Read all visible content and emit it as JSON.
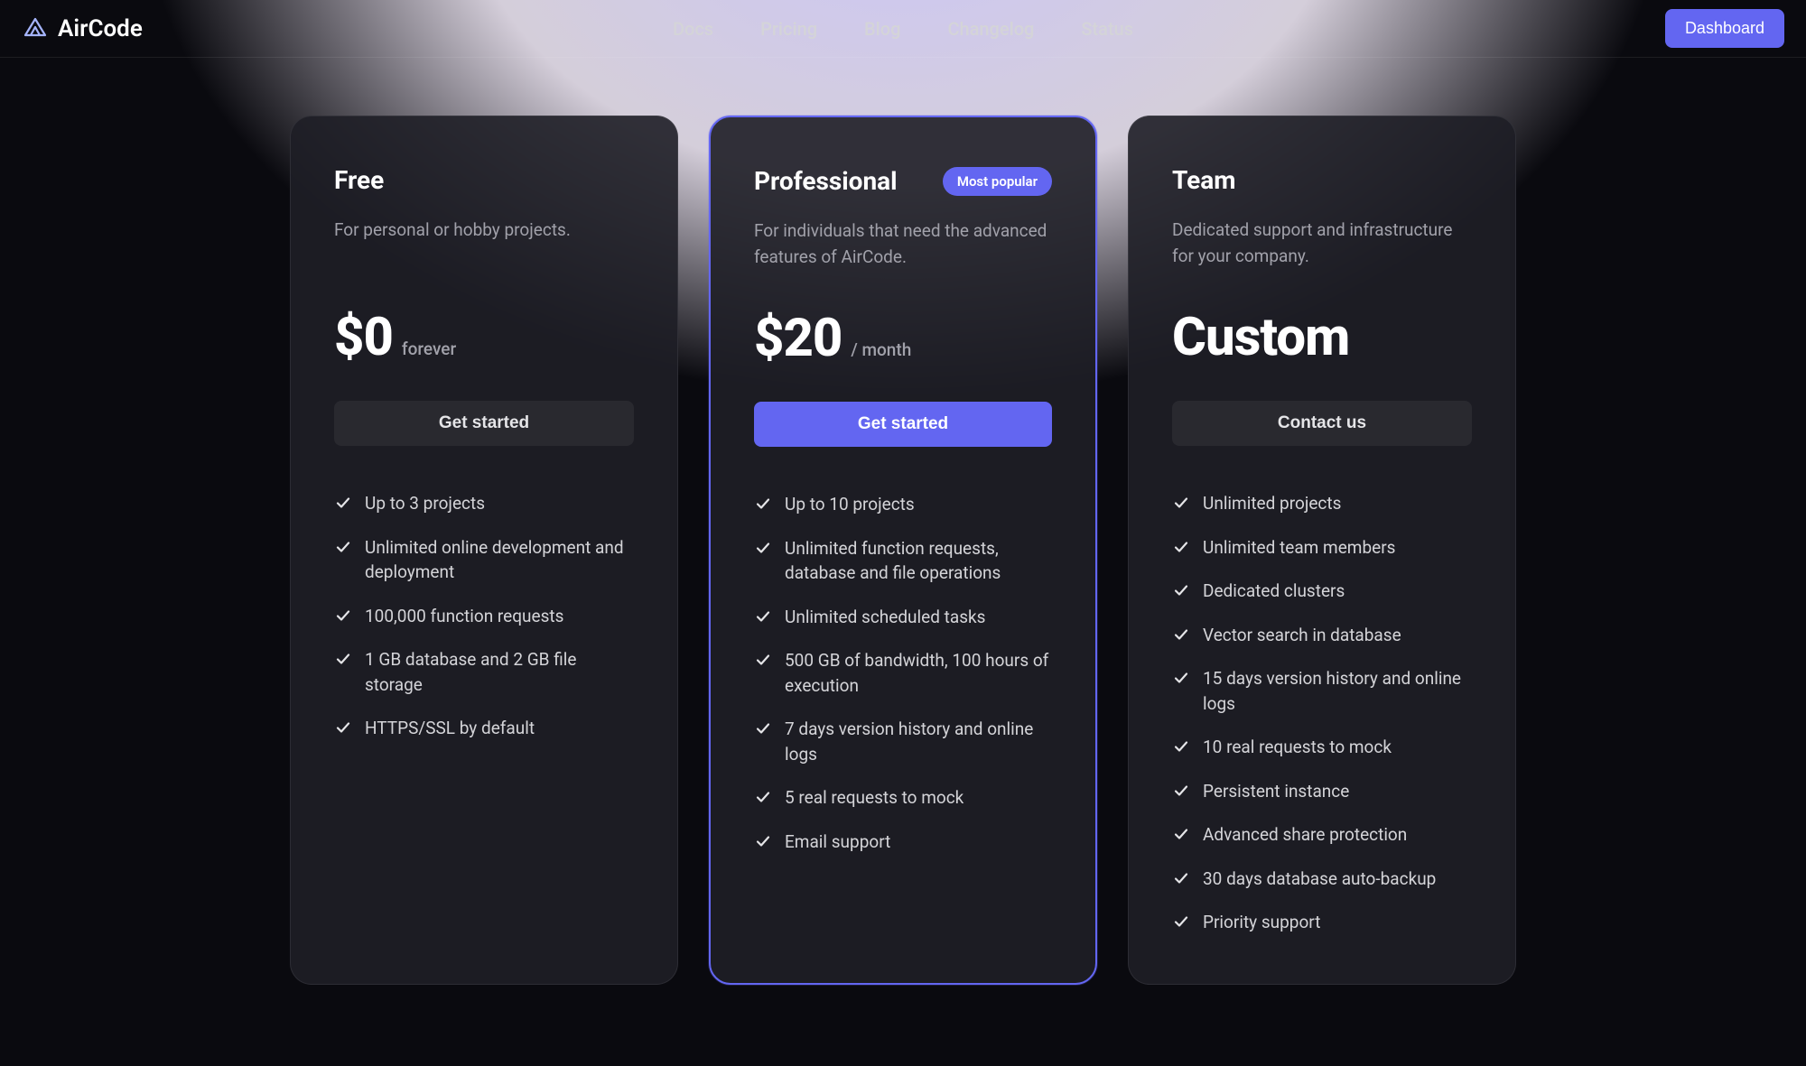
{
  "brand": "AirCode",
  "nav": {
    "docs": "Docs",
    "pricing": "Pricing",
    "blog": "Blog",
    "changelog": "Changelog",
    "status": "Status"
  },
  "dashboard_btn": "Dashboard",
  "plans": {
    "free": {
      "title": "Free",
      "desc": "For personal or hobby projects.",
      "price": "$0",
      "suffix": "forever",
      "cta": "Get started",
      "features": [
        "Up to 3 projects",
        "Unlimited online development and deployment",
        "100,000 function requests",
        "1 GB database and 2 GB file storage",
        "HTTPS/SSL by default"
      ]
    },
    "pro": {
      "title": "Professional",
      "badge": "Most popular",
      "desc": "For individuals that need the advanced features of AirCode.",
      "price": "$20",
      "suffix": "/ month",
      "cta": "Get started",
      "features": [
        "Up to 10 projects",
        "Unlimited function requests, database and file operations",
        "Unlimited scheduled tasks",
        "500 GB of bandwidth, 100 hours of execution",
        "7 days version history and online logs",
        "5 real requests to mock",
        "Email support"
      ]
    },
    "team": {
      "title": "Team",
      "desc": "Dedicated support and infrastructure for your company.",
      "price": "Custom",
      "cta": "Contact us",
      "features": [
        "Unlimited projects",
        "Unlimited team members",
        "Dedicated clusters",
        "Vector search in database",
        "15 days version history and online logs",
        "10 real requests to mock",
        "Persistent instance",
        "Advanced share protection",
        "30 days database auto-backup",
        "Priority support"
      ]
    }
  }
}
